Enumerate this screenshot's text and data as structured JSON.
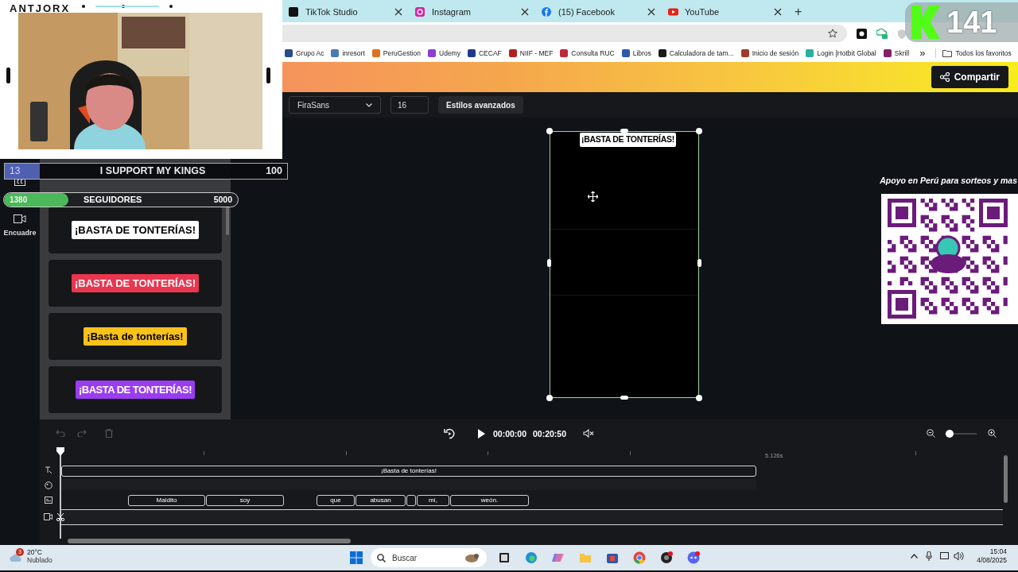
{
  "overlay": {
    "channel_name": "ANTJORX",
    "goal_bar": {
      "count": "13",
      "title": "I SUPPORT MY KINGS",
      "target": "100"
    },
    "followers_bar": {
      "current": "1380",
      "title": "SEGUIDORES",
      "target": "5000",
      "level": 0.276
    },
    "counter": {
      "value": "141"
    },
    "donation": {
      "caption": "Apoyo en Perú para sorteos y mas"
    }
  },
  "browser": {
    "tabs": [
      {
        "title": "TikTok Studio",
        "selected": false
      },
      {
        "title": "Instagram",
        "selected": false
      },
      {
        "title": "(15) Facebook",
        "selected": false
      },
      {
        "title": "YouTube",
        "selected": false
      }
    ],
    "new_tab": "+",
    "bookmarks": [
      {
        "label": "Grupo Ac",
        "color": "#2a4a8a"
      },
      {
        "label": "inresort",
        "color": "#4a7ab0"
      },
      {
        "label": "PeruGestion",
        "color": "#e07020"
      },
      {
        "label": "Udemy",
        "color": "#8a3fd1"
      },
      {
        "label": "CECAF",
        "color": "#1f3a8a"
      },
      {
        "label": "NIIF - MEF",
        "color": "#b02020"
      },
      {
        "label": "Consulta RUC",
        "color": "#c0283a"
      },
      {
        "label": "Libros",
        "color": "#2a5ab0"
      },
      {
        "label": "Calculadora de tam...",
        "color": "#1a1a1a"
      },
      {
        "label": "Inicio de sesión",
        "color": "#a03a2a"
      },
      {
        "label": "Login |Hotbit Global",
        "color": "#2ab0a0"
      },
      {
        "label": "Skrill",
        "color": "#862165"
      }
    ],
    "more": "»",
    "all_bookmarks": "Todos los favoritos"
  },
  "editor": {
    "share_button": "Compartir",
    "font": "FiraSans",
    "font_size": "16",
    "advanced_styles": "Estilos avanzados",
    "sidebar_label": "Encuadre",
    "presets": [
      {
        "text": "¡BASTA DE TONTERÍAS!",
        "color": "#ffffff"
      },
      {
        "text": "¡BASTA DE TONTERÍAS!",
        "color": "#e8374f"
      },
      {
        "text": "¡Basta de tonterías!",
        "color": "#f8c21c"
      },
      {
        "text": "¡BASTA DE TONTERÍAS!",
        "color": "#9a3cf0"
      }
    ],
    "canvas": {
      "caption": "¡BASTA DE TONTERÍAS!"
    },
    "timeline": {
      "current_time": "00:00:00",
      "duration": "00:20:50",
      "zoom": {
        "level": 0.15
      },
      "ruler_label": "5.126s",
      "text_clip": "¡Basta de tonterías!",
      "caption_clips": [
        {
          "kind": "word",
          "text": "Maldito"
        },
        {
          "kind": "word",
          "text": "soy"
        },
        {
          "kind": "word",
          "text": "que"
        },
        {
          "kind": "word",
          "text": "abusan"
        },
        {
          "kind": "blank"
        },
        {
          "kind": "word",
          "text": "mí,"
        },
        {
          "kind": "word",
          "text": "weón."
        }
      ]
    }
  },
  "taskbar": {
    "weather": {
      "temperature": "20°C",
      "condition": "Nublado",
      "badge": "3"
    },
    "search_placeholder": "Buscar",
    "time": "15:04",
    "date": "4/08/2025"
  }
}
